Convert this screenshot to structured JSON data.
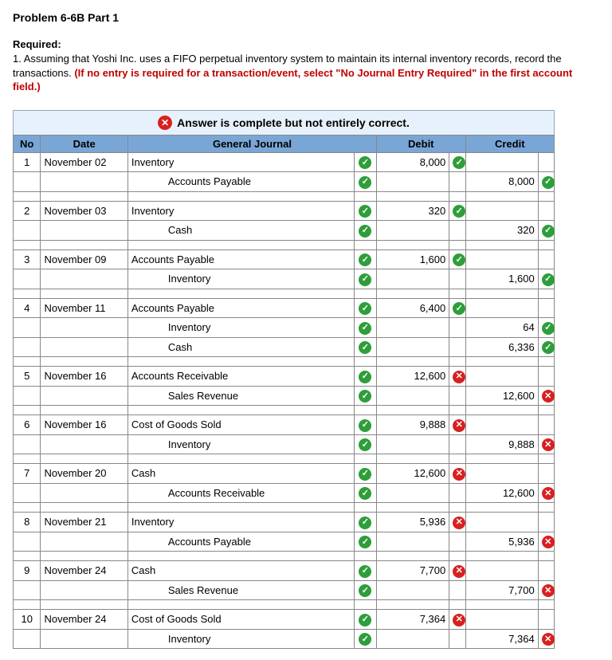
{
  "title": "Problem 6-6B Part 1",
  "required_label": "Required:",
  "required_text_prefix": "1. Assuming that Yoshi Inc. uses a FIFO perpetual inventory system to maintain its internal inventory records, record the transactions. ",
  "required_text_red": "(If no entry is required for a transaction/event, select \"No Journal Entry Required\" in the first account field.)",
  "banner": {
    "icon": "x",
    "text": "Answer is complete but not entirely correct."
  },
  "headers": {
    "no": "No",
    "date": "Date",
    "journal": "General Journal",
    "debit": "Debit",
    "credit": "Credit"
  },
  "entries": [
    {
      "no": "1",
      "date": "November 02",
      "lines": [
        {
          "account": "Inventory",
          "mark": "chk",
          "debit": "8,000",
          "dmark": "chk",
          "credit": "",
          "cmark": ""
        },
        {
          "account": "Accounts Payable",
          "mark": "chk",
          "debit": "",
          "dmark": "",
          "credit": "8,000",
          "cmark": "chk",
          "indent": true
        }
      ]
    },
    {
      "no": "2",
      "date": "November 03",
      "lines": [
        {
          "account": "Inventory",
          "mark": "chk",
          "debit": "320",
          "dmark": "chk",
          "credit": "",
          "cmark": ""
        },
        {
          "account": "Cash",
          "mark": "chk",
          "debit": "",
          "dmark": "",
          "credit": "320",
          "cmark": "chk",
          "indent": true
        }
      ]
    },
    {
      "no": "3",
      "date": "November 09",
      "lines": [
        {
          "account": "Accounts Payable",
          "mark": "chk",
          "debit": "1,600",
          "dmark": "chk",
          "credit": "",
          "cmark": ""
        },
        {
          "account": "Inventory",
          "mark": "chk",
          "debit": "",
          "dmark": "",
          "credit": "1,600",
          "cmark": "chk",
          "indent": true
        }
      ]
    },
    {
      "no": "4",
      "date": "November 11",
      "lines": [
        {
          "account": "Accounts Payable",
          "mark": "chk",
          "debit": "6,400",
          "dmark": "chk",
          "credit": "",
          "cmark": ""
        },
        {
          "account": "Inventory",
          "mark": "chk",
          "debit": "",
          "dmark": "",
          "credit": "64",
          "cmark": "chk",
          "indent": true
        },
        {
          "account": "Cash",
          "mark": "chk",
          "debit": "",
          "dmark": "",
          "credit": "6,336",
          "cmark": "chk",
          "indent": true
        }
      ]
    },
    {
      "no": "5",
      "date": "November 16",
      "lines": [
        {
          "account": "Accounts Receivable",
          "mark": "chk",
          "debit": "12,600",
          "dmark": "xmk",
          "credit": "",
          "cmark": ""
        },
        {
          "account": "Sales Revenue",
          "mark": "chk",
          "debit": "",
          "dmark": "",
          "credit": "12,600",
          "cmark": "xmk",
          "indent": true
        }
      ]
    },
    {
      "no": "6",
      "date": "November 16",
      "lines": [
        {
          "account": "Cost of Goods Sold",
          "mark": "chk",
          "debit": "9,888",
          "dmark": "xmk",
          "credit": "",
          "cmark": ""
        },
        {
          "account": "Inventory",
          "mark": "chk",
          "debit": "",
          "dmark": "",
          "credit": "9,888",
          "cmark": "xmk",
          "indent": true
        }
      ]
    },
    {
      "no": "7",
      "date": "November 20",
      "lines": [
        {
          "account": "Cash",
          "mark": "chk",
          "debit": "12,600",
          "dmark": "xmk",
          "credit": "",
          "cmark": ""
        },
        {
          "account": "Accounts Receivable",
          "mark": "chk",
          "debit": "",
          "dmark": "",
          "credit": "12,600",
          "cmark": "xmk",
          "indent": true
        }
      ]
    },
    {
      "no": "8",
      "date": "November 21",
      "lines": [
        {
          "account": "Inventory",
          "mark": "chk",
          "debit": "5,936",
          "dmark": "xmk",
          "credit": "",
          "cmark": ""
        },
        {
          "account": "Accounts Payable",
          "mark": "chk",
          "debit": "",
          "dmark": "",
          "credit": "5,936",
          "cmark": "xmk",
          "indent": true
        }
      ]
    },
    {
      "no": "9",
      "date": "November 24",
      "lines": [
        {
          "account": "Cash",
          "mark": "chk",
          "debit": "7,700",
          "dmark": "xmk",
          "credit": "",
          "cmark": ""
        },
        {
          "account": "Sales Revenue",
          "mark": "chk",
          "debit": "",
          "dmark": "",
          "credit": "7,700",
          "cmark": "xmk",
          "indent": true
        }
      ]
    },
    {
      "no": "10",
      "date": "November 24",
      "lines": [
        {
          "account": "Cost of Goods Sold",
          "mark": "chk",
          "debit": "7,364",
          "dmark": "xmk",
          "credit": "",
          "cmark": ""
        },
        {
          "account": "Inventory",
          "mark": "chk",
          "debit": "",
          "dmark": "",
          "credit": "7,364",
          "cmark": "xmk",
          "indent": true
        }
      ]
    }
  ]
}
